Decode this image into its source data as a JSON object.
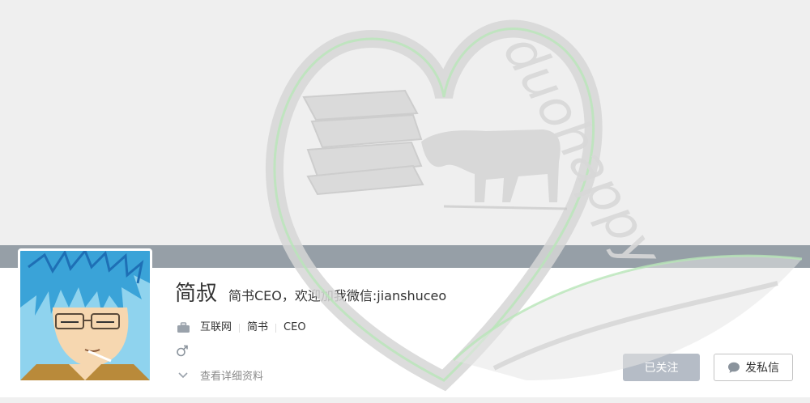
{
  "profile": {
    "name": "简叔",
    "headline": "简书CEO，欢迎加我微信:jianshuceo",
    "tags": [
      "互联网",
      "简书",
      "CEO"
    ],
    "show_details_label": "查看详细资料"
  },
  "icons": {
    "occupation": "briefcase-icon",
    "gender": "male-icon",
    "expand": "chevron-down-icon",
    "message": "chat-bubble-icon"
  },
  "actions": {
    "following_label": "已关注",
    "message_label": "发私信"
  },
  "watermark": {
    "text": "duohappy"
  },
  "colors": {
    "cover_band": "#efefef",
    "cover_strip": "#969fa7",
    "following_button": "#b5bcc6",
    "watermark_green": "#9bd89b"
  }
}
